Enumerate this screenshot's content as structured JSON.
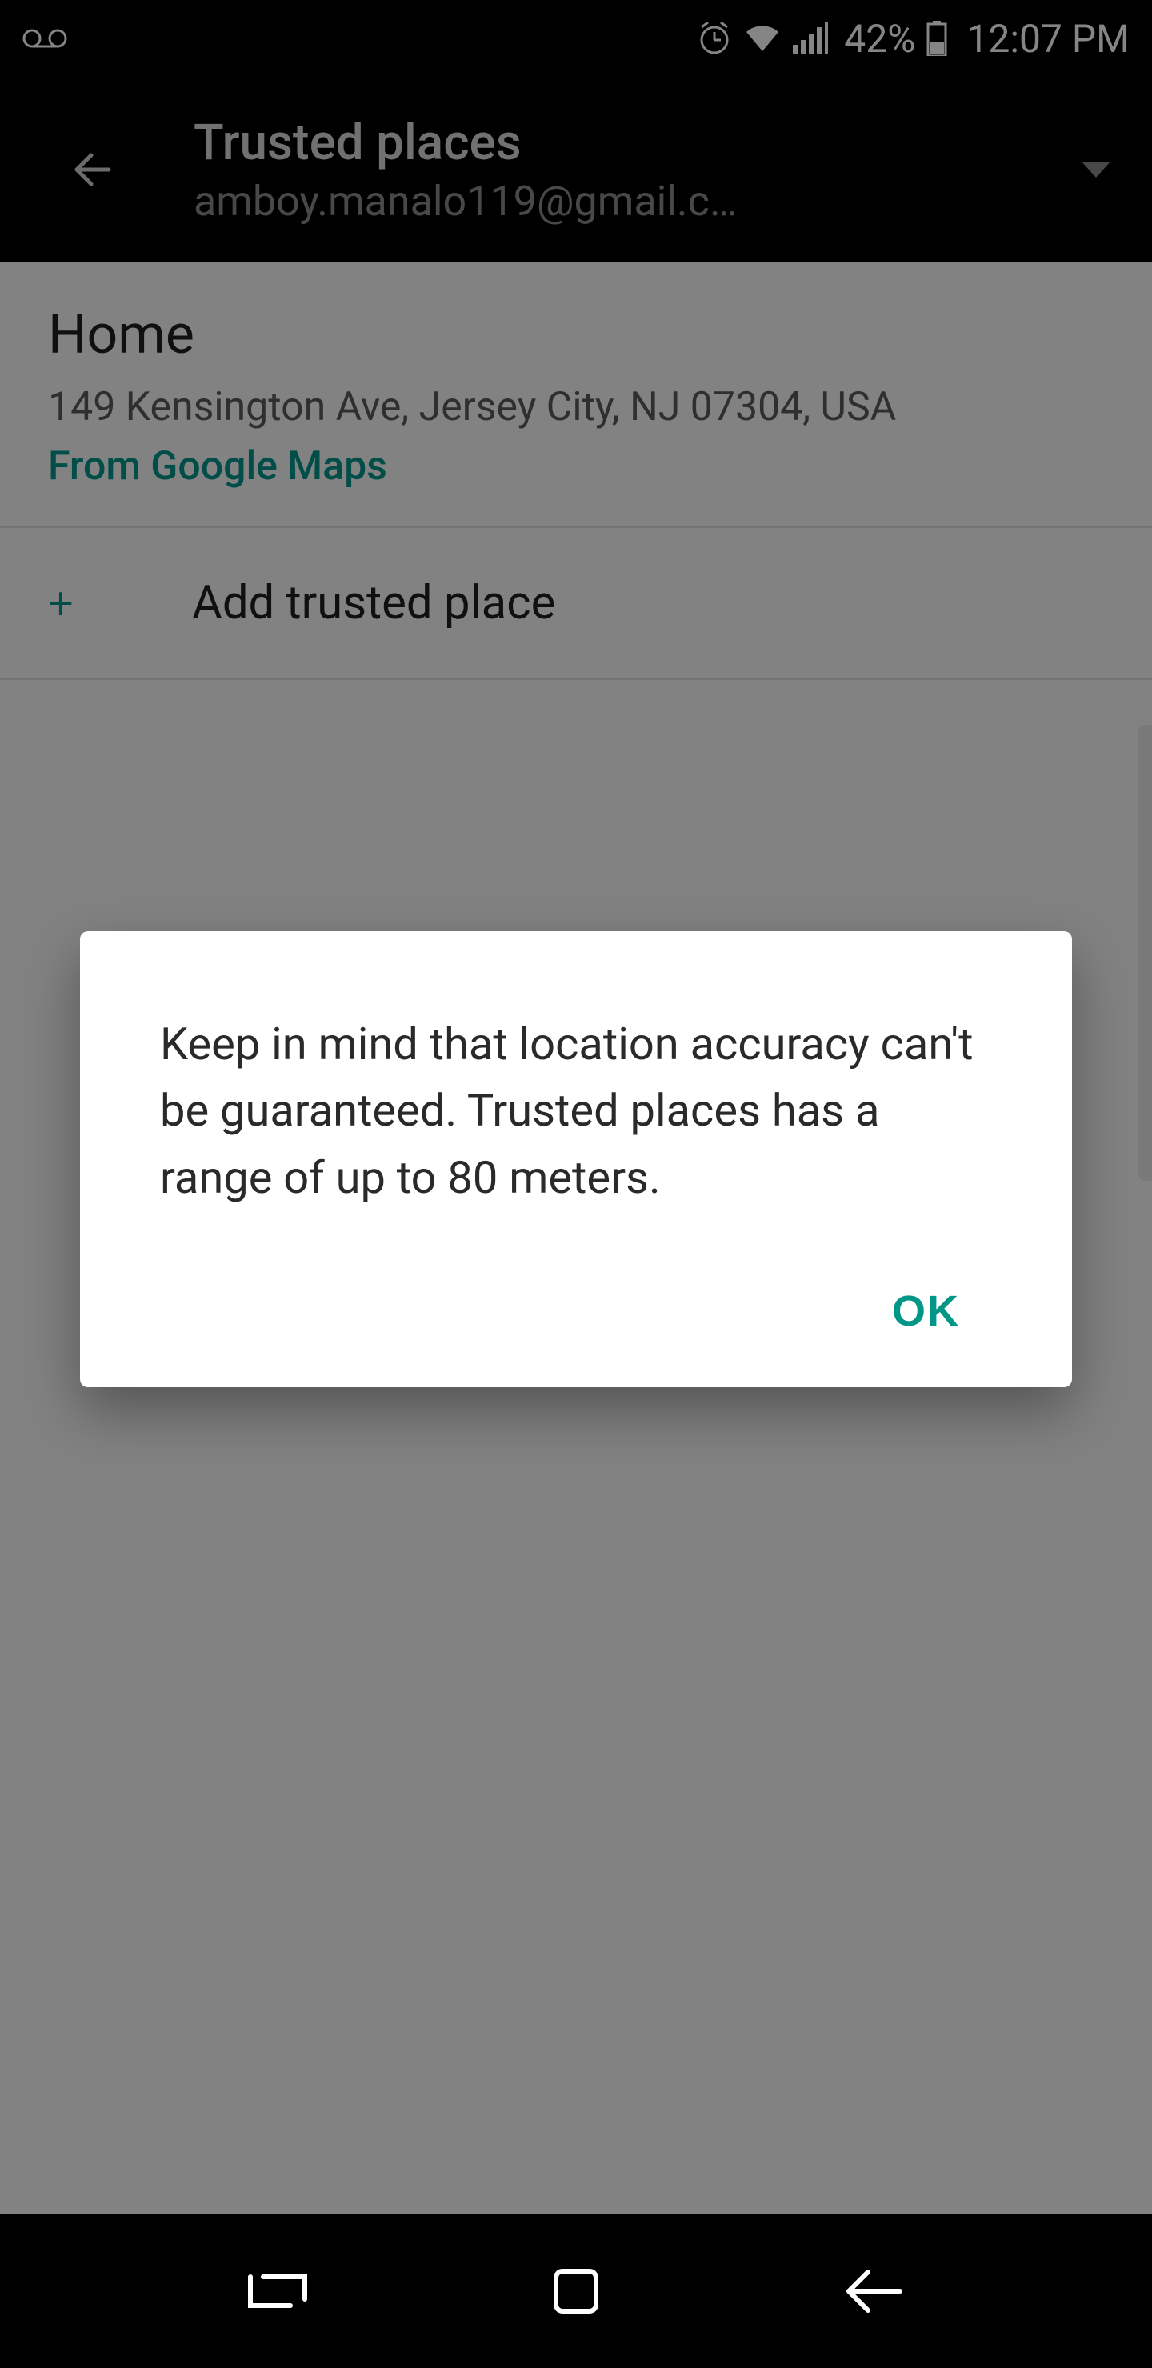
{
  "status": {
    "battery_pct": "42%",
    "time": "12:07 PM"
  },
  "appbar": {
    "title": "Trusted places",
    "subtitle": "amboy.manalo119@gmail.c…"
  },
  "places": [
    {
      "name": "Home",
      "address": "149 Kensington Ave, Jersey City, NJ 07304, USA",
      "source": "From Google Maps"
    }
  ],
  "add_place_label": "Add trusted place",
  "dialog": {
    "message": "Keep in mind that location accuracy can't be guaranteed. Trusted places has a range of up to 80 meters.",
    "ok_label": "OK"
  },
  "colors": {
    "accent": "#009688"
  }
}
